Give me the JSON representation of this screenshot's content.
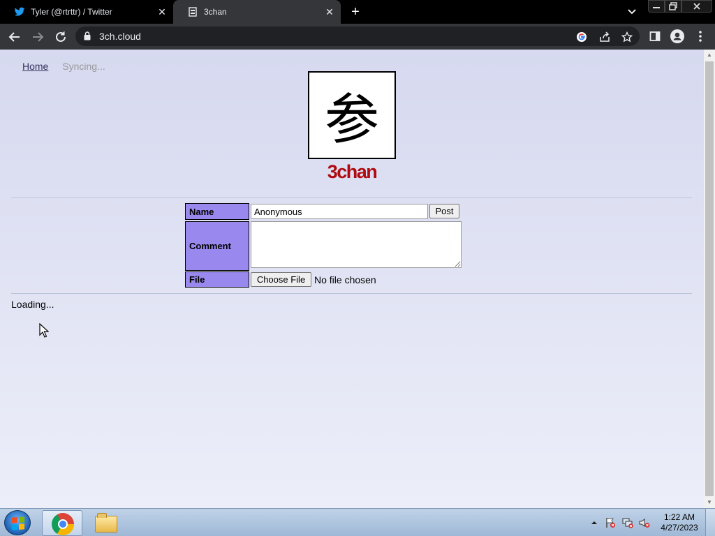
{
  "browser": {
    "tabs": [
      {
        "title": "Tyler (@rtrttr) / Twitter",
        "icon": "twitter-icon",
        "active": false
      },
      {
        "title": "3chan",
        "icon": "page-icon",
        "active": true
      }
    ],
    "new_tab_label": "+",
    "address": "3ch.cloud"
  },
  "page": {
    "nav": {
      "home": "Home",
      "status": "Syncing..."
    },
    "logo_char": "参",
    "site_name": "3chan",
    "form": {
      "name_label": "Name",
      "name_value": "Anonymous",
      "post_button": "Post",
      "comment_label": "Comment",
      "comment_value": "",
      "file_label": "File",
      "file_button": "Choose File",
      "file_status": "No file chosen"
    },
    "loading_text": "Loading..."
  },
  "taskbar": {
    "clock_time": "1:22 AM",
    "clock_date": "4/27/2023"
  },
  "colors": {
    "form_label_bg": "#9988ee",
    "site_name": "#af0a0f",
    "page_bg": "#d6d9ef"
  }
}
